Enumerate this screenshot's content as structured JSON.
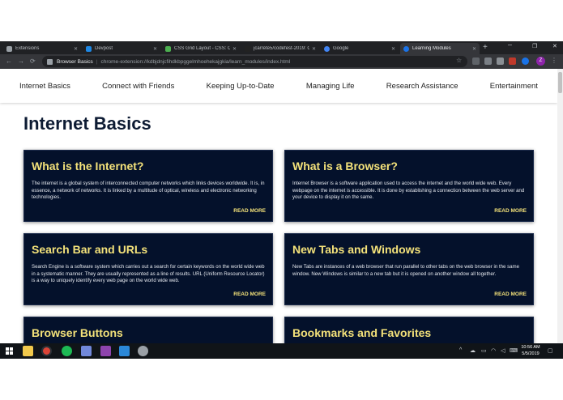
{
  "browser": {
    "tabs": [
      {
        "label": "Extensions",
        "icon_color": "#9aa0a6",
        "active": false
      },
      {
        "label": "Devpost",
        "icon_color": "#1e88e5",
        "active": false
      },
      {
        "label": "CSS Grid Layout - CSS: Cas",
        "icon_color": "#4caf50",
        "active": false
      },
      {
        "label": "jcarrete5/codefest-2019: C",
        "icon_color": "#222222",
        "active": false
      },
      {
        "label": "Google",
        "icon_color": "#4285f4",
        "active": false
      },
      {
        "label": "Learning Modules",
        "icon_color": "#1a73e8",
        "active": true
      }
    ],
    "new_tab": "+",
    "window_controls": {
      "minimize": "─",
      "maximize": "❐",
      "close": "✕"
    },
    "nav": {
      "back": "←",
      "forward": "→",
      "reload": "⟳"
    },
    "address": {
      "site_name": "Browser Basics",
      "separator": "|",
      "url": "chrome-extension://kdbjdnjcfihdkbpggelmhoehekajgkia/learn_modules/index.html"
    },
    "star": "☆",
    "avatar_letter": "Z",
    "menu": "⋮"
  },
  "site": {
    "nav_items": [
      "Internet Basics",
      "Connect with Friends",
      "Keeping Up-to-Date",
      "Managing Life",
      "Research Assistance",
      "Entertainment"
    ],
    "page_title": "Internet Basics",
    "cards": [
      {
        "title": "What is the Internet?",
        "body": "The internet is a global system of interconnected computer networks which links devices worldwide. It is, in essence, a network of networks. It is linked by a multitude of optical, wireless and electronic networking technologies.",
        "more": "READ MORE"
      },
      {
        "title": "What is a Browser?",
        "body": "Internet Browser is a software application used to access the internet and the world wide web. Every webpage on the internet is accessible. It is done by establishing a connection between the web server and your device to display it on the same.",
        "more": "READ MORE"
      },
      {
        "title": "Search Bar and URLs",
        "body": "Search Engine is a software system which carries out a search for certain keywords on the world wide web in a systematic manner. They are usually represented as a line of results. URL (Uniform Resource Locator) is a way to uniquely identify every web page on the world wide web.",
        "more": "READ MORE"
      },
      {
        "title": "New Tabs and Windows",
        "body": "New Tabs are instances of a web browser that run parallel to other tabs on the web browser in the same window. New Windows is similar to a new tab but it is opened on another window all together.",
        "more": "READ MORE"
      },
      {
        "title": "Browser Buttons",
        "body": "",
        "more": ""
      },
      {
        "title": "Bookmarks and Favorites",
        "body": "",
        "more": ""
      }
    ],
    "colors": {
      "card_bg": "#04112b",
      "accent_yellow": "#f4e27a",
      "title_navy": "#0d1b33"
    }
  },
  "taskbar": {
    "time": "10:56 AM",
    "date": "5/5/2019",
    "apps": [
      {
        "name": "file-explorer",
        "color": "#f2c94c"
      },
      {
        "name": "chrome",
        "color": "#db4437"
      },
      {
        "name": "spotify",
        "color": "#1db954"
      },
      {
        "name": "discord",
        "color": "#7289da"
      },
      {
        "name": "github-desktop",
        "color": "#8e44ad"
      },
      {
        "name": "vscode",
        "color": "#2b88d8"
      },
      {
        "name": "app",
        "color": "#9aa0a6"
      }
    ]
  }
}
